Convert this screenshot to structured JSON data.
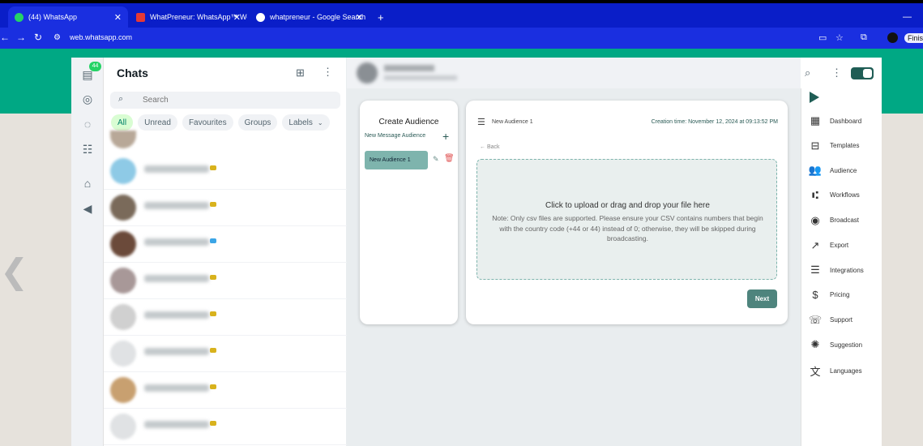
{
  "browser": {
    "tabs": [
      {
        "title": "(44) WhatsApp"
      },
      {
        "title": "WhatPreneur: WhatsApp™ Web"
      },
      {
        "title": "whatpreneur - Google Search"
      }
    ],
    "new_tab": "+",
    "url": "web.whatsapp.com",
    "profile_label": "Finish"
  },
  "rail": {
    "badge": "44"
  },
  "chats": {
    "title": "Chats",
    "search_placeholder": "Search",
    "filters": [
      "All",
      "Unread",
      "Favourites",
      "Groups",
      "Labels"
    ],
    "rows": 8
  },
  "audience": {
    "card_title": "Create Audience",
    "new_label": "New Message Audience",
    "items": [
      {
        "label": "New Audience 1"
      }
    ],
    "name": "New Audience 1",
    "creation": "Creation time: November 12, 2024 at 09:13:52 PM",
    "back": "Back",
    "upload_head": "Click to upload or drag and drop your file here",
    "upload_note": "Note: Only csv files are supported. Please ensure your CSV contains numbers that begin with the country code (+44 or 44) instead of 0; otherwise, they will be skipped during broadcasting.",
    "next": "Next"
  },
  "menu": {
    "items": [
      {
        "label": "Dashboard",
        "icon": "dashboard-icon"
      },
      {
        "label": "Templates",
        "icon": "templates-icon"
      },
      {
        "label": "Audience",
        "icon": "audience-icon"
      },
      {
        "label": "Workflows",
        "icon": "workflows-icon"
      },
      {
        "label": "Broadcast",
        "icon": "broadcast-icon"
      },
      {
        "label": "Export",
        "icon": "export-icon"
      },
      {
        "label": "Integrations",
        "icon": "integrations-icon"
      },
      {
        "label": "Pricing",
        "icon": "pricing-icon"
      },
      {
        "label": "Support",
        "icon": "support-icon"
      },
      {
        "label": "Suggestion",
        "icon": "suggestion-icon"
      },
      {
        "label": "Languages",
        "icon": "languages-icon"
      }
    ]
  },
  "colors": {
    "accent": "#1f5d55",
    "wa_green": "#00a884",
    "browser_blue": "#1a2fe0"
  }
}
